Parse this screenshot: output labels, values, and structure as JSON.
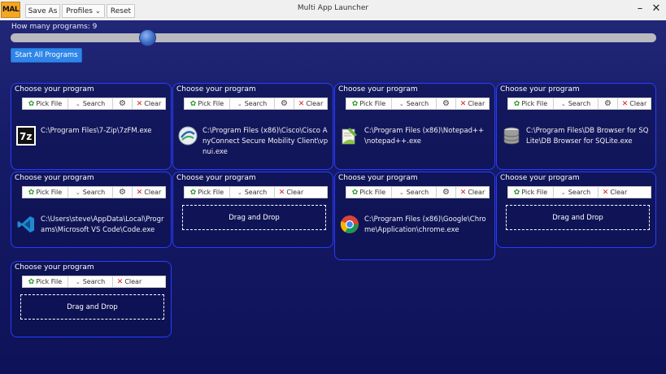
{
  "window": {
    "title": "Multi App Launcher",
    "logo": "MAL",
    "minimize": "–",
    "close": "✕"
  },
  "toolbar": {
    "save_as": "Save As",
    "profiles": "Profiles",
    "reset": "Reset"
  },
  "slider": {
    "label": "How many programs: 9",
    "value": 9
  },
  "start_all": "Start All Programs",
  "card_title": "Choose your program",
  "card_buttons": {
    "pick": "Pick File",
    "search": "Search",
    "clear": "Clear"
  },
  "drop_text": "Drag and Drop",
  "cards": [
    {
      "path": "C:\\Program Files\\7-Zip\\7zFM.exe",
      "icon": "7zip-icon"
    },
    {
      "path": "C:\\Program Files (x86)\\Cisco\\Cisco AnyConnect Secure Mobility Client\\vpnui.exe",
      "icon": "cisco-anyconnect-icon"
    },
    {
      "path": "C:\\Program Files (x86)\\Notepad++\\notepad++.exe",
      "icon": "notepadpp-icon"
    },
    {
      "path": "C:\\Program Files\\DB Browser for SQLite\\DB Browser for SQLite.exe",
      "icon": "db-browser-icon"
    },
    {
      "path": "C:\\Users\\steve\\AppData\\Local\\Programs\\Microsoft VS Code\\Code.exe",
      "icon": "vscode-icon"
    },
    {
      "path": "",
      "icon": ""
    },
    {
      "path": "C:\\Program Files (x86)\\Google\\Chrome\\Application\\chrome.exe",
      "icon": "chrome-icon"
    },
    {
      "path": "",
      "icon": ""
    },
    {
      "path": "",
      "icon": ""
    }
  ]
}
